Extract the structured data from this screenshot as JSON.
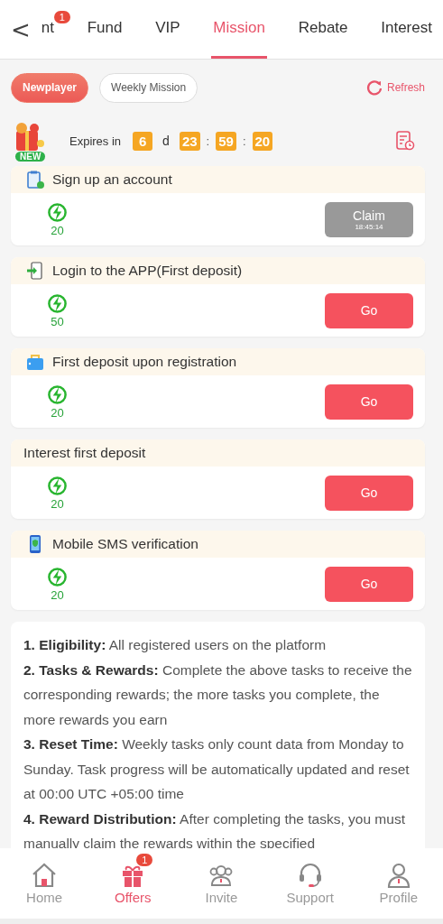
{
  "back": "<",
  "tabs": [
    {
      "label": "nt",
      "selected": false,
      "badge": "1"
    },
    {
      "label": "Fund",
      "selected": false
    },
    {
      "label": "VIP",
      "selected": false
    },
    {
      "label": "Mission",
      "selected": true
    },
    {
      "label": "Rebate",
      "selected": false
    },
    {
      "label": "Interest",
      "selected": false
    }
  ],
  "filters": [
    {
      "label": "Newplayer",
      "selected": true
    },
    {
      "label": "Weekly Mission",
      "selected": false
    }
  ],
  "refresh": "Refresh",
  "expires": {
    "label": "Expires in",
    "new_badge": "NEW",
    "days": "6",
    "day_unit": "d",
    "hours": "23",
    "minutes": "59",
    "seconds": "20",
    "sep": ":"
  },
  "tasks": [
    {
      "title": "Sign up an account",
      "reward": "20",
      "button": {
        "kind": "claim",
        "label": "Claim",
        "time": "18:45:14"
      }
    },
    {
      "title": "Login to the APP(First deposit)",
      "reward": "50",
      "button": {
        "kind": "go",
        "label": "Go"
      }
    },
    {
      "title": "First deposit upon registration",
      "reward": "20",
      "button": {
        "kind": "go",
        "label": "Go"
      }
    },
    {
      "title": "Interest first deposit",
      "reward": "20",
      "button": {
        "kind": "go",
        "label": "Go"
      }
    },
    {
      "title": "Mobile SMS verification",
      "reward": "20",
      "button": {
        "kind": "go",
        "label": "Go"
      }
    }
  ],
  "rules": [
    "**1. Eligibility:** All registered users on the platform",
    "**2. Tasks & Rewards:** Complete the above tasks to receive the corresponding rewards; the more tasks you complete, the more rewards you earn",
    "**3. Reset Time:** Weekly tasks only count data from Monday to Sunday. Task progress will be automatically updated and reset at 00:00 UTC +05:00 time",
    "**4. Reward Distribution:** After completing the tasks, you must manually claim the rewards within the specified"
  ],
  "nav": [
    {
      "label": "Home",
      "selected": false
    },
    {
      "label": "Offers",
      "selected": true,
      "badge": "1"
    },
    {
      "label": "Invite",
      "selected": false
    },
    {
      "label": "Support",
      "selected": false
    },
    {
      "label": "Profile",
      "selected": false
    }
  ]
}
